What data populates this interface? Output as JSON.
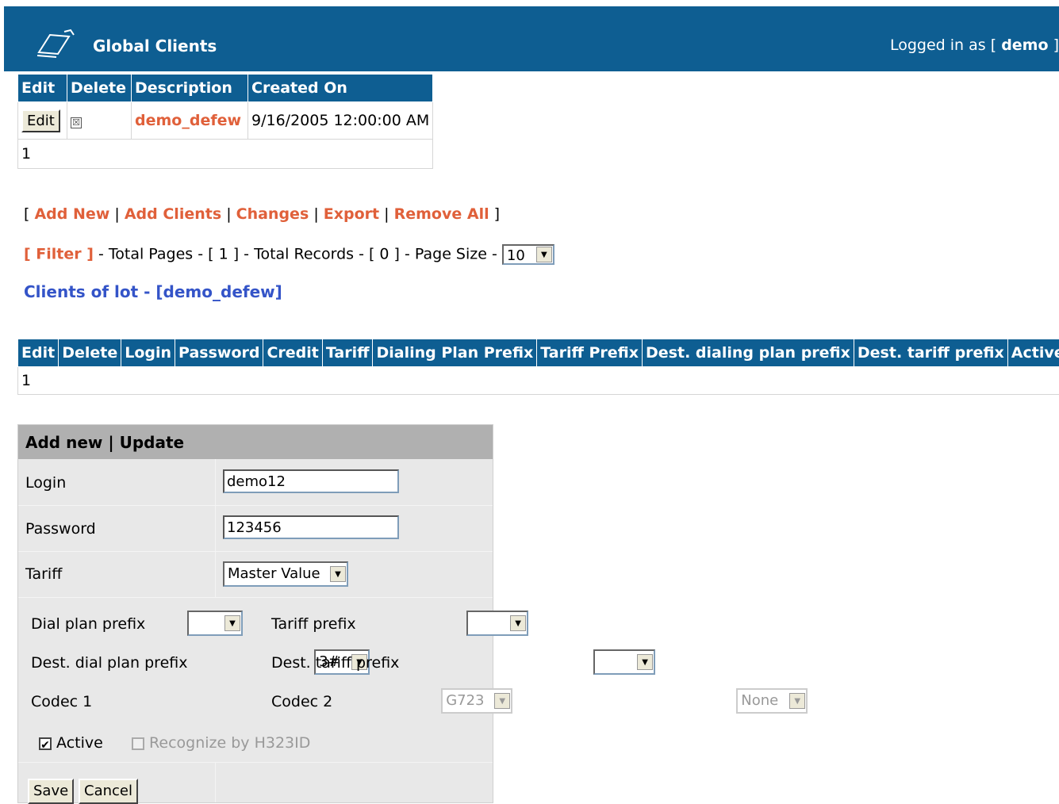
{
  "header": {
    "title": "Global Clients",
    "logged_in_prefix": "Logged in as [",
    "user": "demo",
    "logged_in_suffix": "]"
  },
  "lots_table": {
    "columns": [
      "Edit",
      "Delete",
      "Description",
      "Created On"
    ],
    "rows": [
      {
        "edit_label": "Edit",
        "delete_icon": "☒",
        "description": "demo_defew",
        "created_on": "9/16/2005 12:00:00 AM"
      }
    ],
    "page": "1"
  },
  "actions": {
    "open": "[",
    "add_new": "Add New",
    "add_clients": "Add Clients",
    "changes": "Changes",
    "export": "Export",
    "remove_all": "Remove All",
    "close": "]",
    "sep": "|"
  },
  "pager": {
    "filter": "[ Filter ]",
    "total_pages_text": "- Total Pages - [ 1 ] - Total Records - [ 0 ] - Page Size -",
    "page_size": "10"
  },
  "clients": {
    "title": "Clients of lot - [demo_defew]",
    "columns": [
      "Edit",
      "Delete",
      "Login",
      "Password",
      "Credit",
      "Tariff",
      "Dialing Plan Prefix",
      "Tariff Prefix",
      "Dest. dialing plan prefix",
      "Dest. tariff prefix",
      "Active"
    ],
    "page": "1"
  },
  "form": {
    "header": "Add new | Update",
    "login_label": "Login",
    "login_value": "demo12",
    "password_label": "Password",
    "password_value": "123456",
    "tariff_label": "Tariff",
    "tariff_value": "Master Value",
    "dial_plan_prefix_label": "Dial plan prefix",
    "dial_plan_prefix_value": "",
    "tariff_prefix_label": "Tariff prefix",
    "tariff_prefix_value": "",
    "dest_dial_plan_prefix_label": "Dest. dial plan prefix",
    "dest_dial_plan_prefix_value": "3#",
    "dest_tariff_prefix_label": "Dest. tariff prefix",
    "dest_tariff_prefix_value": "",
    "codec1_label": "Codec 1",
    "codec1_value": "G723",
    "codec2_label": "Codec 2",
    "codec2_value": "None",
    "active_label": "Active",
    "active_checked": true,
    "recognize_label": "Recognize by H323ID",
    "save_label": "Save",
    "cancel_label": "Cancel"
  },
  "colors": {
    "header_blue": "#0e5e92",
    "link_orange": "#e0603a",
    "title_blue": "#3454c8"
  }
}
